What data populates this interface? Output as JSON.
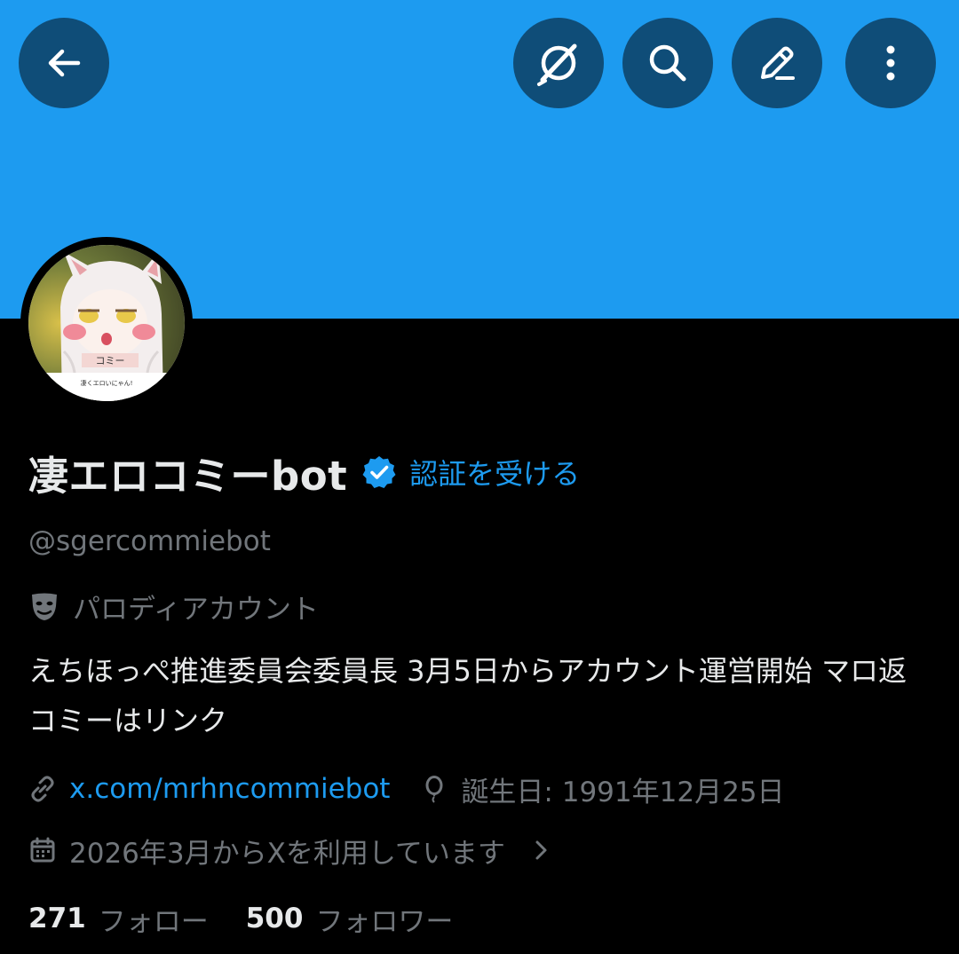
{
  "colors": {
    "banner": "#1d9bf0",
    "header_button_bg": "#0f4d78",
    "background": "#000000",
    "primary_text": "#e7e9ea",
    "secondary_text": "#71767b",
    "accent": "#1d9bf0"
  },
  "header": {
    "buttons": [
      {
        "name": "back-arrow-icon"
      },
      {
        "name": "grok-icon"
      },
      {
        "name": "search-icon"
      },
      {
        "name": "edit-icon"
      },
      {
        "name": "more-vertical-icon"
      }
    ]
  },
  "profile": {
    "display_name": "凄エロコミーbot",
    "verified_badge": "verified-badge-icon",
    "get_verified_label": "認証を受ける",
    "handle": "@sgercommiebot",
    "parody_label": "パロディアカウント",
    "bio": "えちほっぺ推進委員会委員長 3月5日からアカウント運営開始 マロ返コミーはリンク",
    "website": "x.com/mrhncommiebot",
    "birthday": "誕生日: 1991年12月25日",
    "joined": "2026年3月からXを利用しています",
    "avatar_caption": "コミー",
    "avatar_subcaption": "凄くエロいにゃん!"
  },
  "stats": {
    "following_count": "271",
    "following_label": "フォロー",
    "followers_count": "500",
    "followers_label": "フォロワー"
  }
}
